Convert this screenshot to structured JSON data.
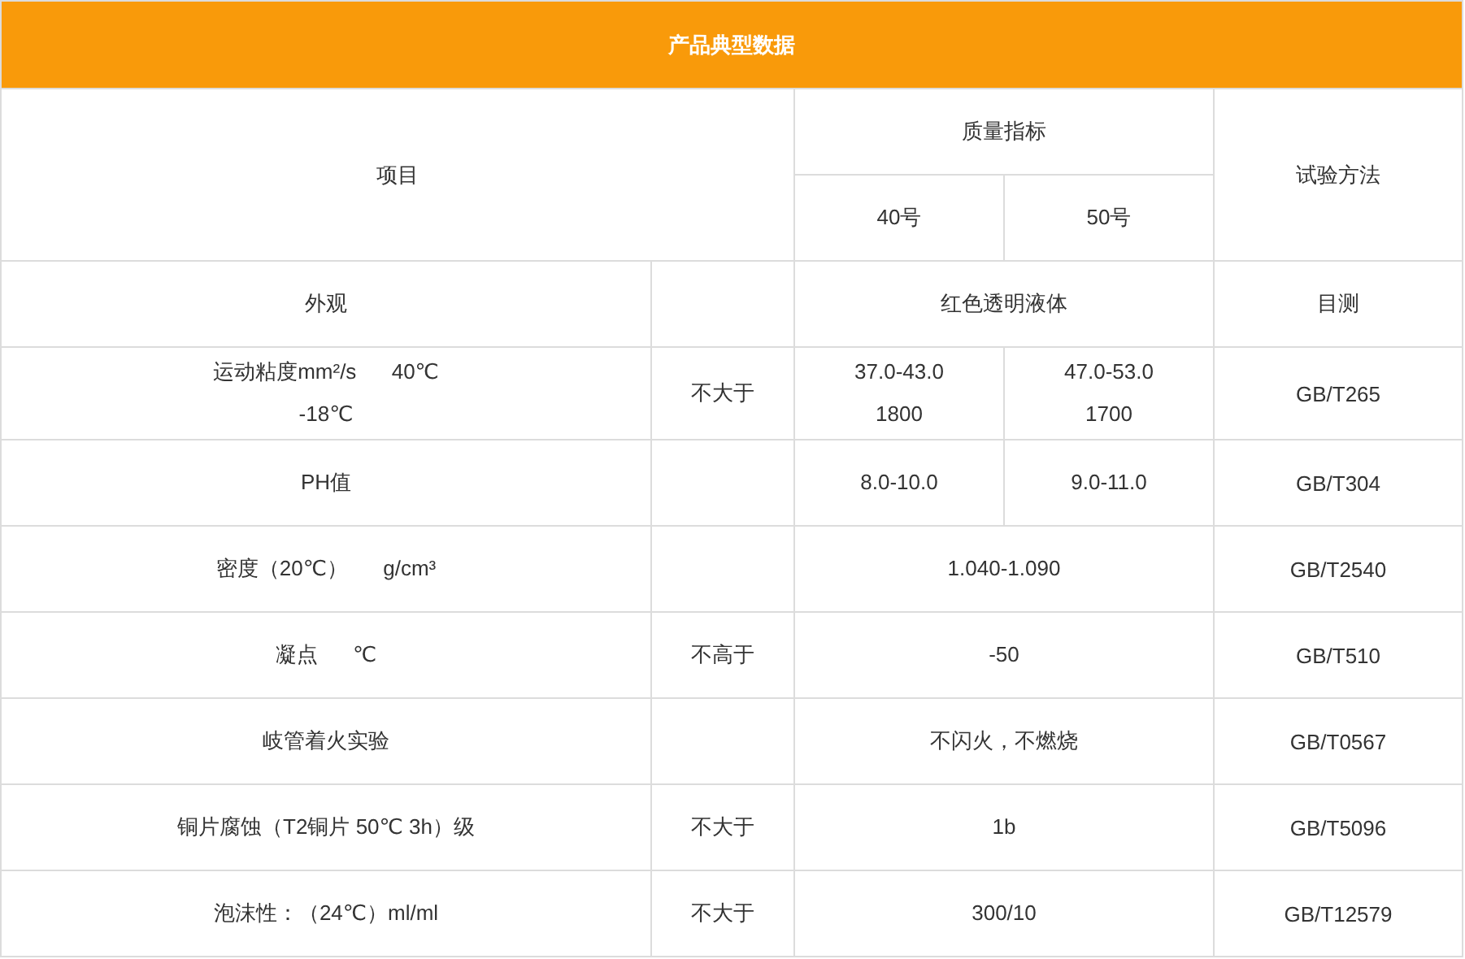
{
  "title": "产品典型数据",
  "header": {
    "item": "项目",
    "quality": "质量指标",
    "grades": [
      "40号",
      "50号"
    ],
    "method": "试验方法"
  },
  "rows": [
    {
      "item": [
        "外观"
      ],
      "values": [
        [
          "红色透明液体"
        ]
      ],
      "method": "目测"
    },
    {
      "item": [
        "运动粘度mm²/s      40℃",
        "-18℃"
      ],
      "limit": "不大于",
      "values": [
        [
          "37.0-43.0",
          "1800"
        ],
        [
          "47.0-53.0",
          "1700"
        ]
      ],
      "method": "GB/T265"
    },
    {
      "item": [
        "PH值"
      ],
      "values": [
        [
          "8.0-10.0"
        ],
        [
          "9.0-11.0"
        ]
      ],
      "method": "GB/T304"
    },
    {
      "item": [
        "密度（20℃）      g/cm³"
      ],
      "values": [
        [
          "1.040-1.090"
        ]
      ],
      "method": "GB/T2540"
    },
    {
      "item": [
        "凝点      ℃"
      ],
      "limit": "不高于",
      "values": [
        [
          "-50"
        ]
      ],
      "method": "GB/T510"
    },
    {
      "item": [
        "岐管着火实验"
      ],
      "values": [
        [
          "不闪火，不燃烧"
        ]
      ],
      "method": "GB/T0567"
    },
    {
      "item": [
        "铜片腐蚀（T2铜片 50℃ 3h）级"
      ],
      "limit": "不大于",
      "values": [
        [
          "1b"
        ]
      ],
      "method": "GB/T5096"
    },
    {
      "item": [
        "泡沫性：（24℃）ml/ml"
      ],
      "limit": "不大于",
      "values": [
        [
          "300/10"
        ]
      ],
      "method": "GB/T12579"
    }
  ]
}
